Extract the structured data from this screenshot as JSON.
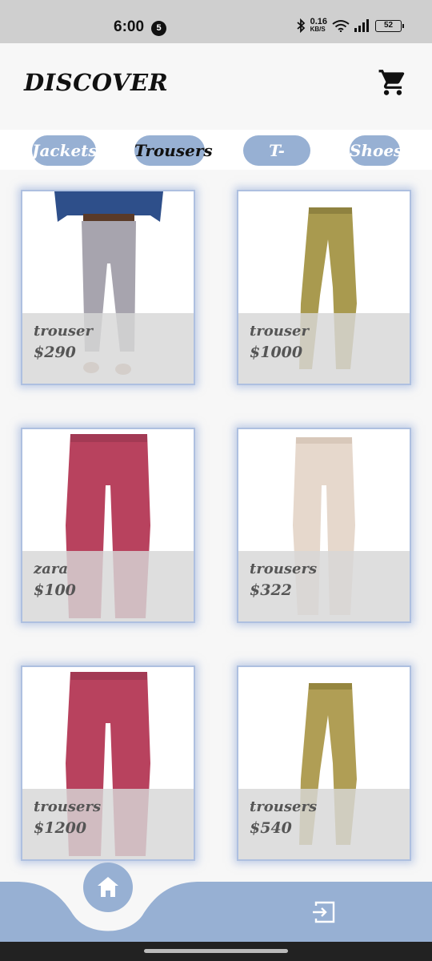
{
  "status_bar": {
    "time": "6:00",
    "notification_count": "5",
    "network_speed": "0.16",
    "network_unit": "KB/S",
    "battery": "52"
  },
  "header": {
    "title": "DISCOVER",
    "cart_icon": "cart-icon"
  },
  "tabs": [
    {
      "label": "Jackets",
      "active": false
    },
    {
      "label": "Trousers",
      "active": true
    },
    {
      "label": "T-Shirts",
      "active": false
    },
    {
      "label": "Shoes",
      "active": false
    }
  ],
  "products": [
    {
      "name": "trouser",
      "price": "$290",
      "color": "#a7a4ae"
    },
    {
      "name": "trouser",
      "price": "$1000",
      "color": "#a99a4f"
    },
    {
      "name": "zara",
      "price": "$100",
      "color": "#b8425e"
    },
    {
      "name": "trousers",
      "price": "$322",
      "color": "#e6d8cc"
    },
    {
      "name": "trousers",
      "price": "$1200",
      "color": "#b8425e"
    },
    {
      "name": "trousers",
      "price": "$540",
      "color": "#b09e55"
    }
  ],
  "bottom_nav": {
    "home_icon": "home-icon",
    "logout_icon": "logout-icon",
    "color": "#97b0d3"
  }
}
